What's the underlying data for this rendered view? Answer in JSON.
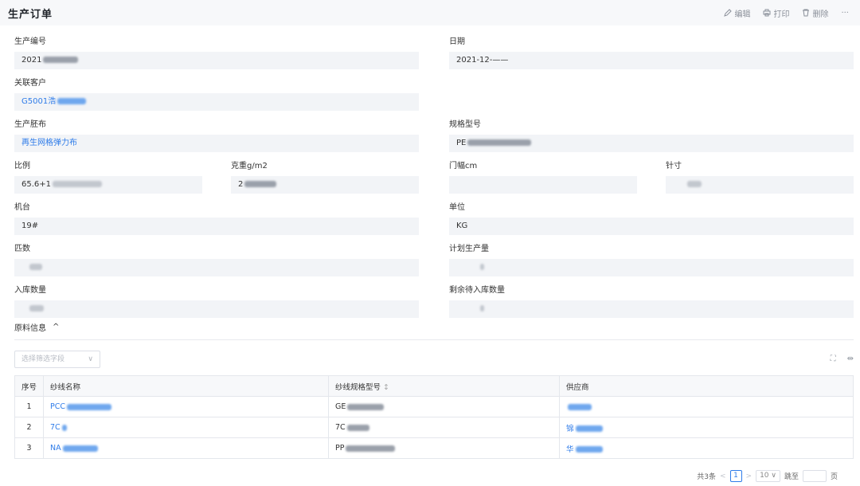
{
  "header": {
    "title": "生产订单",
    "edit": "编辑",
    "print": "打印",
    "delete": "删除",
    "more": "···"
  },
  "fields": {
    "order_no": {
      "label": "生产编号",
      "value": "2021"
    },
    "date": {
      "label": "日期",
      "value": "2021-12-——"
    },
    "customer": {
      "label": "关联客户",
      "value": "G5001浩"
    },
    "fabric": {
      "label": "生产胚布",
      "value": "再生网格弹力布"
    },
    "spec": {
      "label": "规格型号",
      "value": "PE"
    },
    "ratio": {
      "label": "比例",
      "value": "65.6+1"
    },
    "weight": {
      "label": "克重g/m2",
      "value": "2"
    },
    "width": {
      "label": "门幅cm",
      "value": ""
    },
    "needle": {
      "label": "针寸",
      "value": ""
    },
    "machine": {
      "label": "机台",
      "value": "19#"
    },
    "unit": {
      "label": "单位",
      "value": "KG"
    },
    "pieces": {
      "label": "匹数",
      "value": ""
    },
    "planned": {
      "label": "计划生产量",
      "value": ""
    },
    "stock_in": {
      "label": "入库数量",
      "value": ""
    },
    "remaining": {
      "label": "剩余待入库数量",
      "value": ""
    }
  },
  "materials": {
    "section_title": "原料信息",
    "filter_placeholder": "选择筛选字段",
    "columns": {
      "idx": "序号",
      "name": "纱线名称",
      "spec": "纱线规格型号",
      "supplier": "供应商"
    },
    "rows": [
      {
        "idx": "1",
        "name": "PCC",
        "spec": "GE",
        "supplier": ""
      },
      {
        "idx": "2",
        "name": "7C",
        "spec": "7C",
        "supplier": "锦"
      },
      {
        "idx": "3",
        "name": "NA",
        "spec": "PP",
        "supplier": "华"
      }
    ]
  },
  "pager": {
    "total": "共3条",
    "page": "1",
    "size": "10",
    "goto": "跳至",
    "page_unit": "页"
  }
}
